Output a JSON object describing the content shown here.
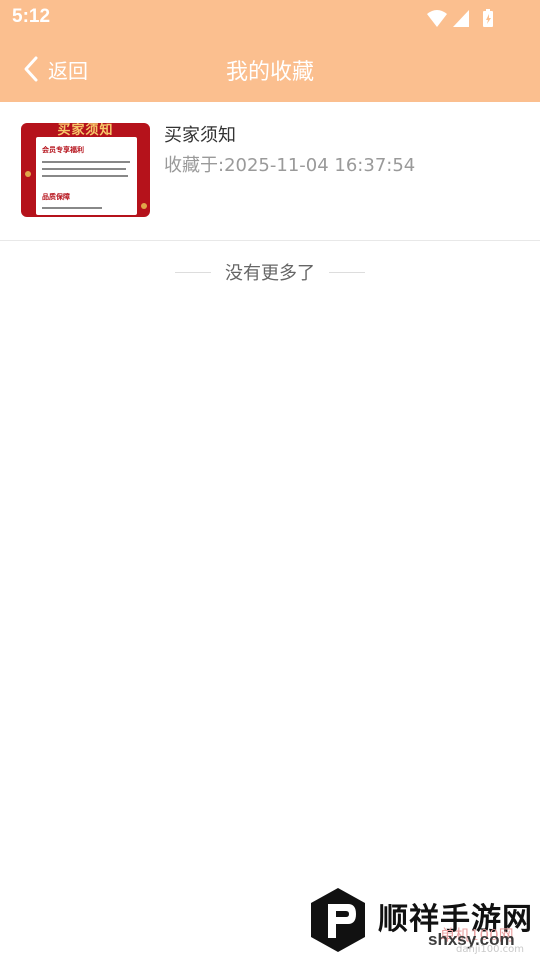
{
  "status_bar": {
    "time": "5:12",
    "icons": [
      "wifi-icon",
      "signal-icon",
      "battery-icon"
    ]
  },
  "header": {
    "back_label": "返回",
    "title": "我的收藏",
    "background": "#fbbf8f"
  },
  "favorites": [
    {
      "title": "买家须知",
      "saved_at": "收藏于:2025-11-04 16:37:54",
      "thumbnail": {
        "banner": "买家须知",
        "heading1": "会员专享福利",
        "heading2": "品质保障"
      }
    }
  ],
  "list_end_text": "没有更多了",
  "watermark": {
    "name": "顺祥手游网",
    "sub": "单机100网",
    "url": "shxsy.com",
    "url2": "danji100.com"
  }
}
